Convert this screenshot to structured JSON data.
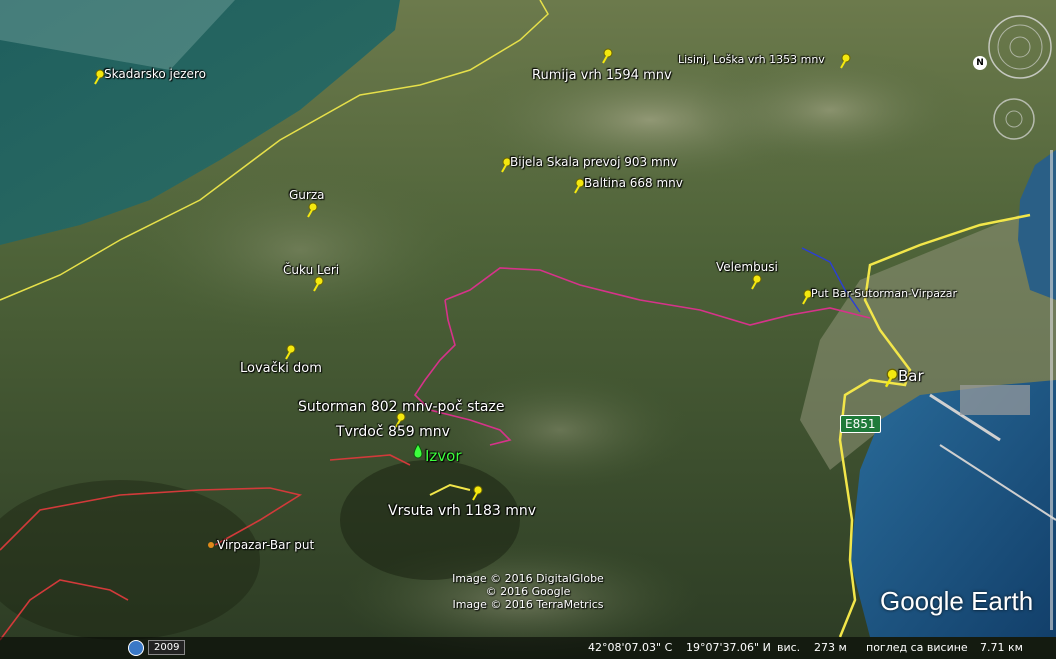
{
  "placemarks": [
    {
      "name": "Skadarsko jezero"
    },
    {
      "name": "Rumija vrh 1594 mnv"
    },
    {
      "name": "Lisinj, Loška vrh 1353 mnv"
    },
    {
      "name": "Bijela Skala prevoj 903 mnv"
    },
    {
      "name": "Baltina 668 mnv"
    },
    {
      "name": "Gurza"
    },
    {
      "name": "Čuku Leri"
    },
    {
      "name": "Velembusi"
    },
    {
      "name": "Put Bar-Sutorman-Virpazar"
    },
    {
      "name": "Lovački dom"
    },
    {
      "name": "Bar"
    },
    {
      "name": "Sutorman 802 mnv-poč staze"
    },
    {
      "name": "Tvrdoč 859 mnv"
    },
    {
      "name": "Izvor"
    },
    {
      "name": "Vrsuta vrh 1183 mnv"
    },
    {
      "name": "Virpazar-Bar put"
    }
  ],
  "road_label": "E851",
  "credits": [
    "Image © 2016 DigitalGlobe",
    "© 2016 Google",
    "Image © 2016 TerraMetrics"
  ],
  "logo": "Google Earth",
  "history_year": "2009",
  "status": {
    "lat": "42°08'07.03\" С",
    "lon": "19°07'37.06\" И",
    "elev_label": "вис.",
    "elev": "273 м",
    "eye_label": "поглед са висине",
    "eye": "7.71 км"
  },
  "compass_letter": "N",
  "colors": {
    "track_pink": "#d6338a",
    "track_red": "#d23a3a",
    "border_yellow": "#e6e04a",
    "road_yellow": "#f2e64a",
    "pin": "#f4e80f"
  }
}
